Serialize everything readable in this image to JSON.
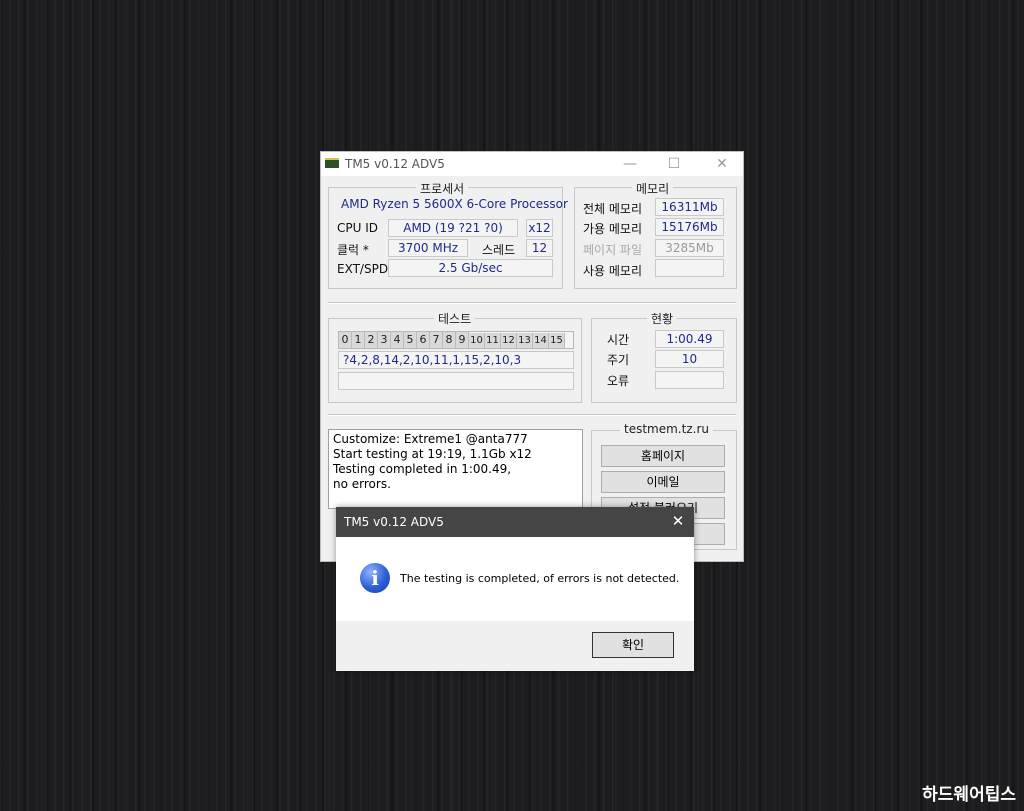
{
  "window": {
    "title": "TM5 v0.12 ADV5",
    "processor": {
      "group_label": "프로세서",
      "name": "AMD Ryzen 5 5600X 6-Core Processor",
      "cpuid_label": "CPU ID",
      "cpuid_value": "AMD  (19 ?21 ?0)",
      "cpuid_mult": "x12",
      "clock_label": "클럭 *",
      "clock_value": "3700 MHz",
      "threads_label": "스레드",
      "threads_value": "12",
      "extspd_label": "EXT/SPD",
      "extspd_value": "2.5 Gb/sec"
    },
    "memory": {
      "group_label": "메모리",
      "total_label": "전체 메모리",
      "total_value": "16311Mb",
      "avail_label": "가용 메모리",
      "avail_value": "15176Mb",
      "page_label": "페이지 파일",
      "page_value": "3285Mb",
      "used_label": "사용 메모리",
      "used_value": ""
    },
    "test": {
      "group_label": "테스트",
      "numbers": [
        "0",
        "1",
        "2",
        "3",
        "4",
        "5",
        "6",
        "7",
        "8",
        "9",
        "10",
        "11",
        "12",
        "13",
        "14",
        "15"
      ],
      "sequence": "?4,2,8,14,2,10,11,1,15,2,10,3",
      "progress_text": ""
    },
    "status": {
      "group_label": "현황",
      "time_label": "시간",
      "time_value": "1:00.49",
      "cycle_label": "주기",
      "cycle_value": "10",
      "errors_label": "오류",
      "errors_value": ""
    },
    "log": {
      "lines": [
        "Customize: Extreme1 @anta777",
        "Start testing at 19:19, 1.1Gb x12",
        "Testing completed in 1:00.49,",
        "no errors."
      ]
    },
    "links": {
      "group_label": "testmem.tz.ru",
      "homepage_label": "홈페이지",
      "email_label": "이메일",
      "load_settings_label": "설정 불러오기",
      "extra_label": ""
    }
  },
  "dialog": {
    "title": "TM5 v0.12 ADV5",
    "message": "The testing is completed, of errors is not detected.",
    "ok_label": "확인",
    "close_glyph": "✕",
    "icon": "info-icon"
  },
  "watermark": "하드웨어팁스",
  "colors": {
    "value_text": "#1f2a8a",
    "dialog_title_bg": "#454545",
    "desktop_bg": "#1d1d1f"
  }
}
